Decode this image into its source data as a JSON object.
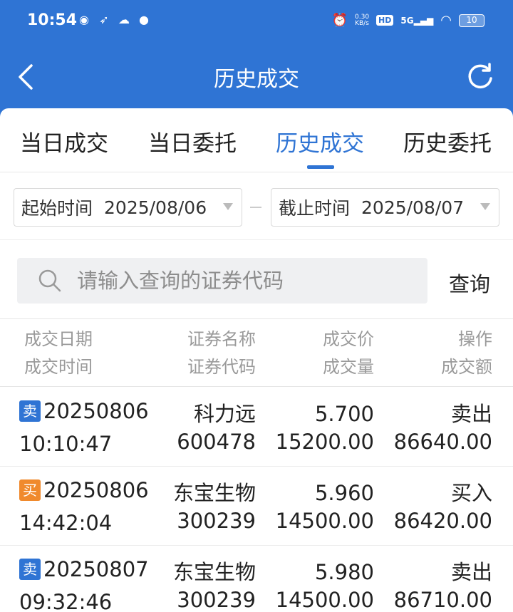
{
  "status_bar": {
    "time": "10:54",
    "net_speed_top": "0.30",
    "net_speed_unit": "KB/s",
    "hd_label": "HD",
    "signal_label": "5G",
    "battery": "10"
  },
  "header": {
    "title": "历史成交",
    "back_icon": "chevron-left-icon",
    "refresh_icon": "refresh-icon"
  },
  "tabs": [
    {
      "label": "当日成交",
      "active": false
    },
    {
      "label": "当日委托",
      "active": false
    },
    {
      "label": "历史成交",
      "active": true
    },
    {
      "label": "历史委托",
      "active": false
    }
  ],
  "filters": {
    "start_label": "起始时间",
    "start_date": "2025/08/06",
    "end_label": "截止时间",
    "end_date": "2025/08/07"
  },
  "search": {
    "placeholder": "请输入查询的证券代码",
    "query_label": "查询"
  },
  "table": {
    "headers": {
      "col1_top": "成交日期",
      "col1_bottom": "成交时间",
      "col2_top": "证券名称",
      "col2_bottom": "证券代码",
      "col3_top": "成交价",
      "col3_bottom": "成交量",
      "col4_top": "操作",
      "col4_bottom": "成交额"
    },
    "rows": [
      {
        "tag": "卖",
        "tag_type": "sell",
        "date": "20250806",
        "time": "10:10:47",
        "name": "科力远",
        "code": "600478",
        "price": "5.700",
        "volume": "15200.00",
        "action": "卖出",
        "amount": "86640.00"
      },
      {
        "tag": "买",
        "tag_type": "buy",
        "date": "20250806",
        "time": "14:42:04",
        "name": "东宝生物",
        "code": "300239",
        "price": "5.960",
        "volume": "14500.00",
        "action": "买入",
        "amount": "86420.00"
      },
      {
        "tag": "卖",
        "tag_type": "sell",
        "date": "20250807",
        "time": "09:32:46",
        "name": "东宝生物",
        "code": "300239",
        "price": "5.980",
        "volume": "14500.00",
        "action": "卖出",
        "amount": "86710.00"
      }
    ]
  },
  "colors": {
    "brand_blue": "#2f74d4",
    "buy_orange": "#f08a2d",
    "header_gray": "#9a9a9a"
  }
}
